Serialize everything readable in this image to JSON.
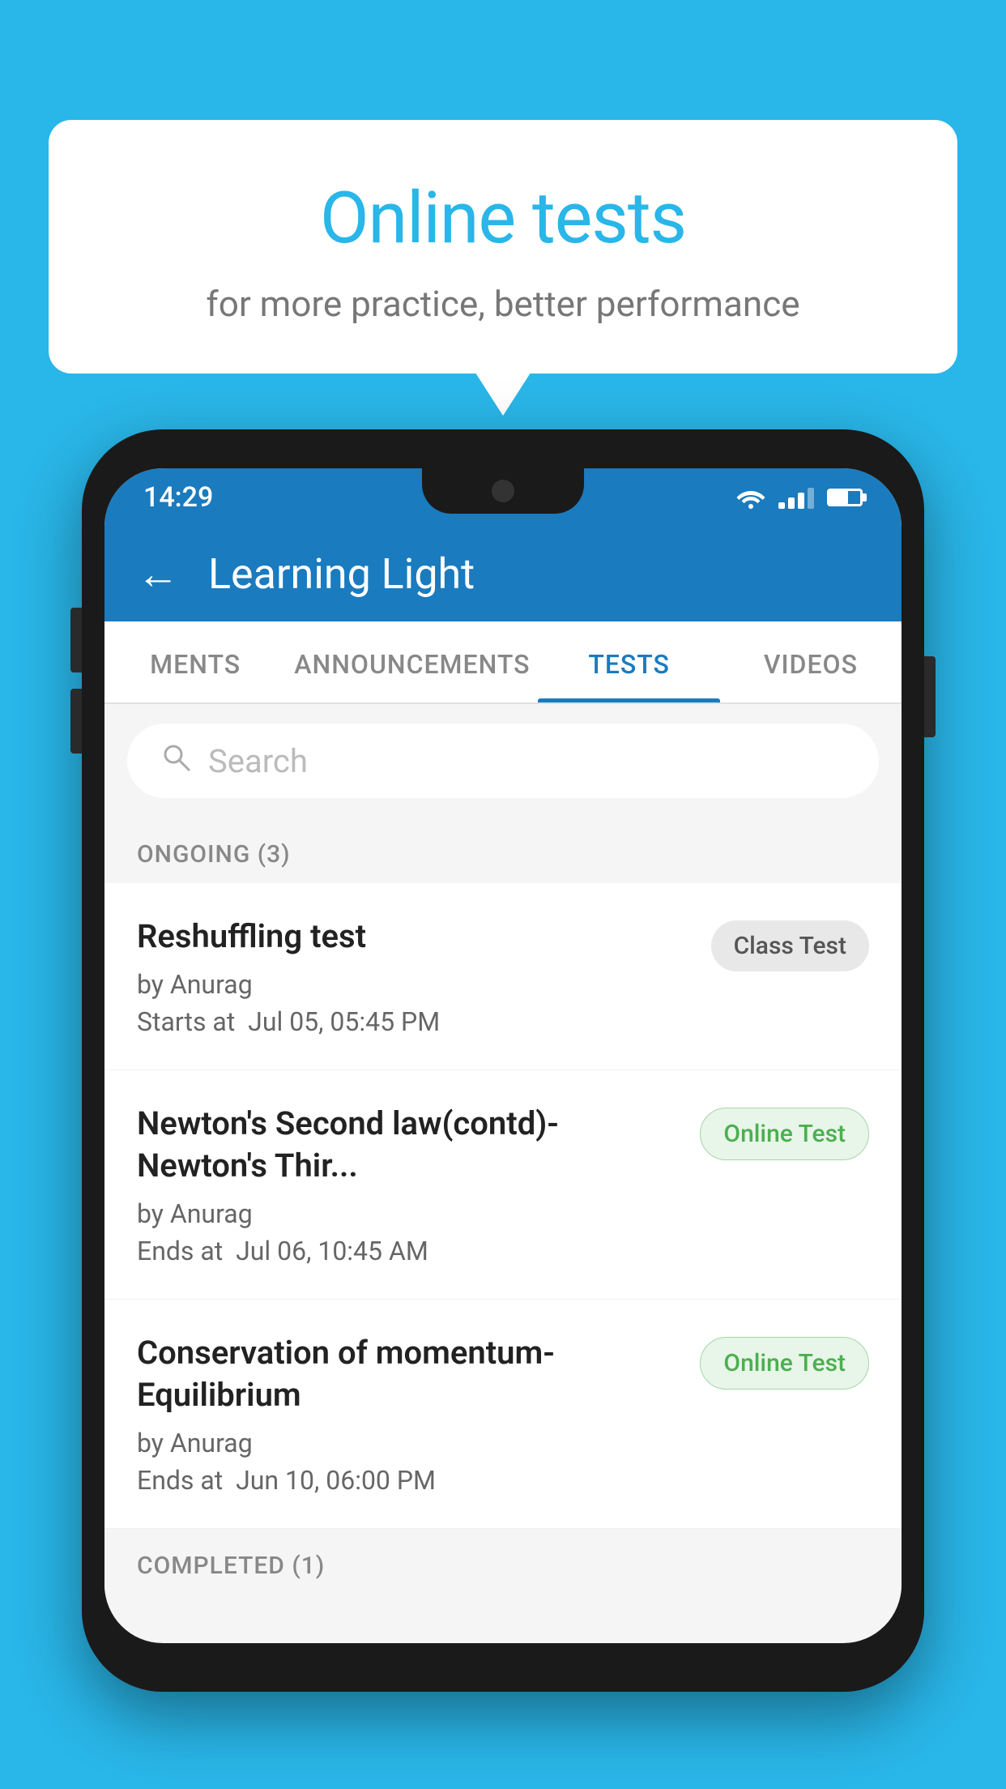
{
  "background_color": "#29b6e8",
  "bubble": {
    "title": "Online tests",
    "subtitle": "for more practice, better performance"
  },
  "status_bar": {
    "time": "14:29",
    "wifi": "▼",
    "battery_percent": 60
  },
  "header": {
    "title": "Learning Light",
    "back_label": "←"
  },
  "tabs": [
    {
      "label": "MENTS",
      "active": false
    },
    {
      "label": "ANNOUNCEMENTS",
      "active": false
    },
    {
      "label": "TESTS",
      "active": true
    },
    {
      "label": "VIDEOS",
      "active": false
    }
  ],
  "search": {
    "placeholder": "Search"
  },
  "ongoing_section": {
    "title": "ONGOING (3)"
  },
  "tests": [
    {
      "name": "Reshuffling test",
      "author": "by Anurag",
      "date_label": "Starts at",
      "date": "Jul 05, 05:45 PM",
      "badge": "Class Test",
      "badge_type": "class"
    },
    {
      "name": "Newton's Second law(contd)-Newton's Thir...",
      "author": "by Anurag",
      "date_label": "Ends at",
      "date": "Jul 06, 10:45 AM",
      "badge": "Online Test",
      "badge_type": "online"
    },
    {
      "name": "Conservation of momentum-Equilibrium",
      "author": "by Anurag",
      "date_label": "Ends at",
      "date": "Jun 10, 06:00 PM",
      "badge": "Online Test",
      "badge_type": "online"
    }
  ],
  "completed_section": {
    "title": "COMPLETED (1)"
  }
}
